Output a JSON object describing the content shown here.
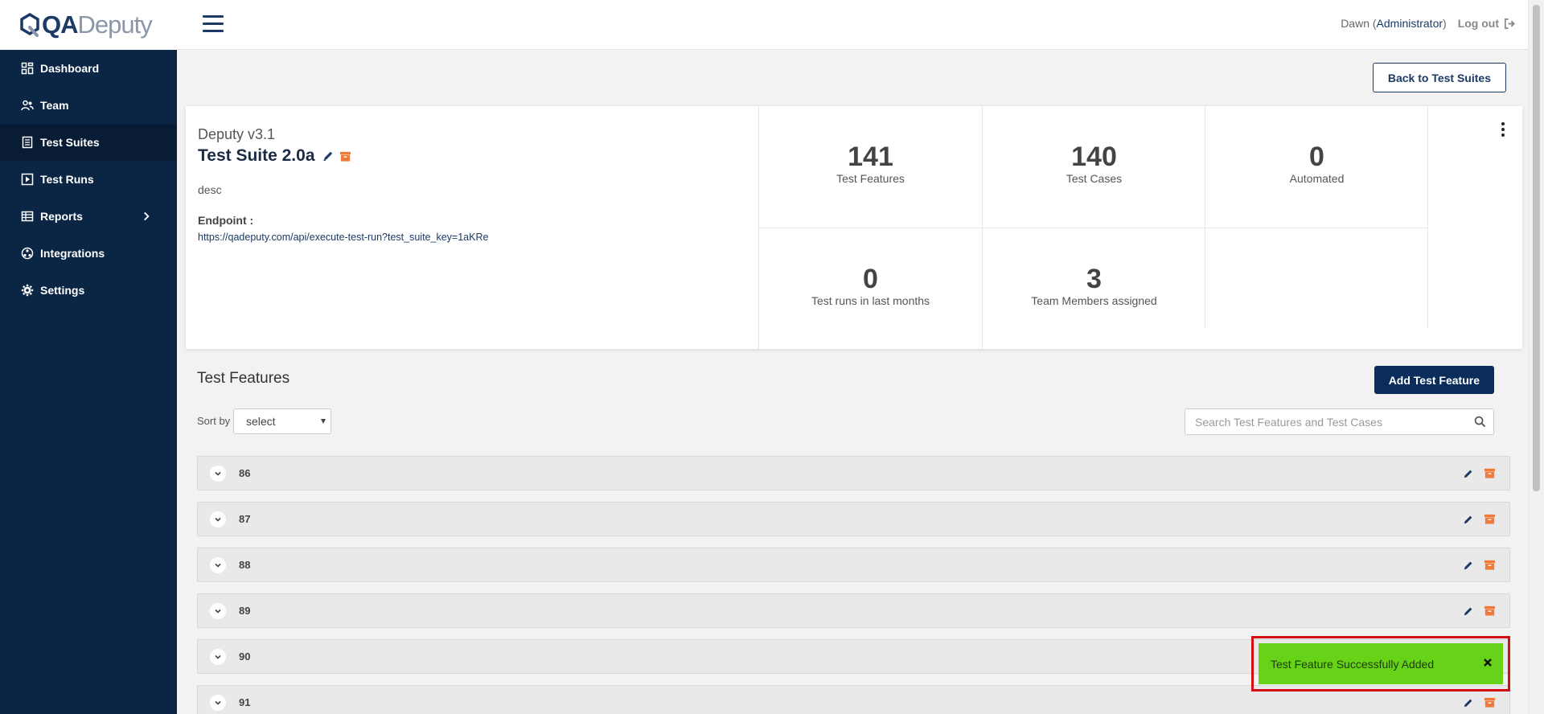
{
  "brand": {
    "qa": "QA",
    "deputy": "Deputy"
  },
  "sidebar": {
    "items": [
      {
        "label": "Dashboard"
      },
      {
        "label": "Team"
      },
      {
        "label": "Test Suites"
      },
      {
        "label": "Test Runs"
      },
      {
        "label": "Reports"
      },
      {
        "label": "Integrations"
      },
      {
        "label": "Settings"
      }
    ],
    "active_item": "Test Suites"
  },
  "header": {
    "user_name": "Dawn",
    "user_role": "Administrator",
    "logout_label": "Log out"
  },
  "main": {
    "back_button": "Back to Test Suites",
    "suite": {
      "project_name": "Deputy v3.1",
      "title": "Test Suite 2.0a",
      "description": "desc",
      "endpoint_label": "Endpoint :",
      "endpoint_url": "https://qadeputy.com/api/execute-test-run?test_suite_key=1aKRe"
    },
    "stats": [
      {
        "value": "141",
        "label": "Test Features"
      },
      {
        "value": "140",
        "label": "Test Cases"
      },
      {
        "value": "0",
        "label": "Automated"
      },
      {
        "value": "0",
        "label": "Test runs in last months"
      },
      {
        "value": "3",
        "label": "Team Members assigned"
      }
    ],
    "features_title": "Test Features",
    "add_feature_button": "Add Test Feature",
    "sort_label": "Sort by",
    "sort_value": "select",
    "search_placeholder": "Search Test Features and Test Cases",
    "feature_rows": [
      {
        "label": "86"
      },
      {
        "label": "87"
      },
      {
        "label": "88"
      },
      {
        "label": "89"
      },
      {
        "label": "90"
      },
      {
        "label": "91"
      }
    ]
  },
  "toast": {
    "message": "Test Feature Successfully Added"
  },
  "colors": {
    "sidebar_bg": "#0b2545",
    "primary": "#1b3a66",
    "accent_orange": "#f07a3a",
    "toast_green": "#66d218",
    "highlight_red": "#d40f14"
  }
}
